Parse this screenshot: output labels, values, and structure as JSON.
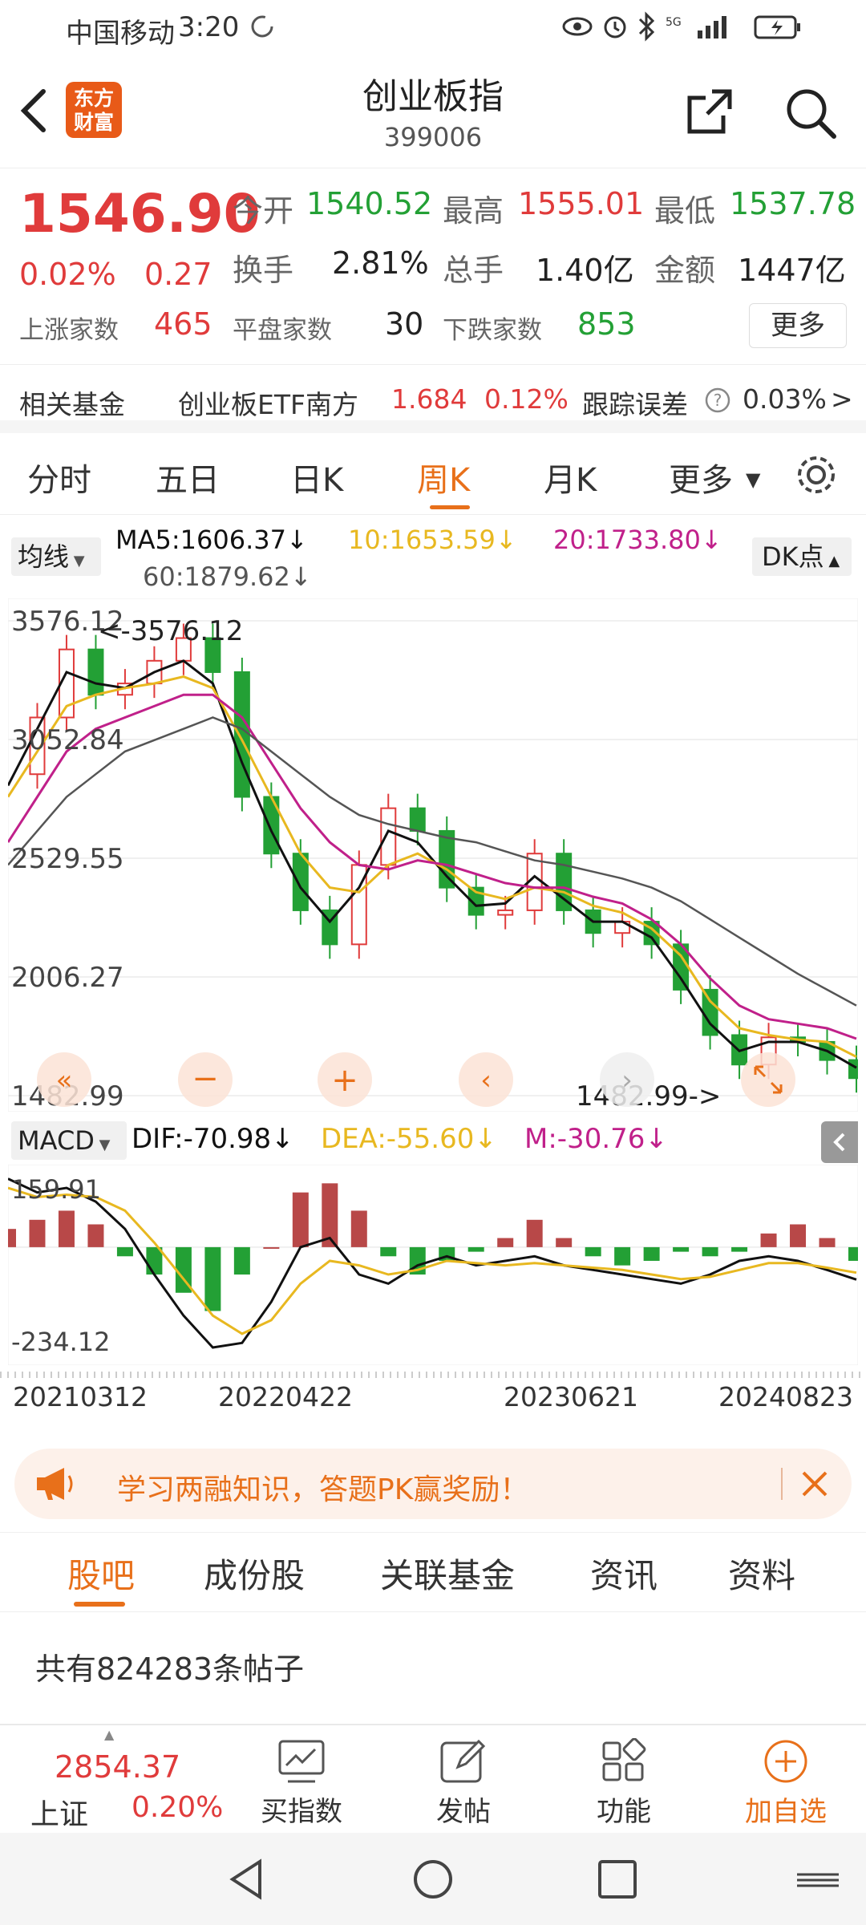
{
  "status": {
    "carrier": "中国移动",
    "time": "3:20"
  },
  "header": {
    "logo_line1": "东方",
    "logo_line2": "财富",
    "title": "创业板指",
    "code": "399006"
  },
  "quote": {
    "price": "1546.90",
    "change_pct": "0.02%",
    "change": "0.27",
    "open_label": "今开",
    "open": "1540.52",
    "high_label": "最高",
    "high": "1555.01",
    "low_label": "最低",
    "low": "1537.78",
    "turnover_label": "换手",
    "turnover": "2.81%",
    "volume_label": "总手",
    "volume": "1.40亿",
    "amount_label": "金额",
    "amount": "1447亿",
    "up_label": "上涨家数",
    "up": "465",
    "flat_label": "平盘家数",
    "flat": "30",
    "down_label": "下跌家数",
    "down": "853",
    "more_button": "更多"
  },
  "fund": {
    "label": "相关基金",
    "name": "创业板ETF南方",
    "price": "1.684",
    "pct": "0.12%",
    "track_label": "跟踪误差",
    "track_value": "0.03%"
  },
  "tabs": [
    "分时",
    "五日",
    "日K",
    "周K",
    "月K",
    "更多"
  ],
  "ma": {
    "selector": "均线",
    "ma5": "MA5:1606.37↓",
    "ma10": "10:1653.59↓",
    "ma20": "20:1733.80↓",
    "ma60": "60:1879.62↓",
    "dk_button": "DK点"
  },
  "chart_data": [
    {
      "type": "candlestick",
      "y_ticks": [
        "3576.12",
        "3052.84",
        "2529.55",
        "2006.27",
        "1482.99"
      ],
      "ylim": [
        1482.99,
        3576.12
      ],
      "max_label": "<-3576.12",
      "min_label": "1482.99->",
      "x_ticks": [
        "20210312",
        "20220422",
        "20230621",
        "20240823"
      ],
      "series": [
        {
          "values": [
            2900,
            3150,
            3450,
            3250,
            3300,
            3400,
            3500,
            3350,
            2800,
            2550,
            2300,
            2150,
            2500,
            2750,
            2650,
            2400,
            2280,
            2300,
            2550,
            2300,
            2200,
            2250,
            2150,
            1950,
            1750,
            1620,
            1740,
            1720,
            1640,
            1560
          ]
        },
        {
          "values": [
            2850,
            3100,
            3350,
            3300,
            3280,
            3350,
            3400,
            3300,
            2950,
            2650,
            2400,
            2250,
            2400,
            2650,
            2600,
            2450,
            2320,
            2330,
            2450,
            2350,
            2250,
            2250,
            2180,
            2000,
            1800,
            1680,
            1720,
            1720,
            1680,
            1606
          ]
        },
        {
          "values": [
            2800,
            3000,
            3200,
            3250,
            3280,
            3300,
            3330,
            3280,
            3050,
            2800,
            2550,
            2400,
            2380,
            2500,
            2550,
            2480,
            2380,
            2350,
            2400,
            2380,
            2320,
            2290,
            2220,
            2100,
            1900,
            1780,
            1750,
            1730,
            1720,
            1654
          ]
        },
        {
          "values": [
            2600,
            2800,
            3000,
            3100,
            3150,
            3200,
            3250,
            3250,
            3150,
            2950,
            2750,
            2600,
            2500,
            2480,
            2520,
            2500,
            2460,
            2420,
            2400,
            2400,
            2360,
            2330,
            2260,
            2150,
            2000,
            1880,
            1820,
            1800,
            1780,
            1734
          ]
        },
        {
          "values": [
            2500,
            2650,
            2800,
            2900,
            3000,
            3050,
            3100,
            3150,
            3100,
            3000,
            2900,
            2800,
            2720,
            2680,
            2650,
            2620,
            2600,
            2560,
            2520,
            2500,
            2470,
            2440,
            2400,
            2340,
            2260,
            2180,
            2100,
            2020,
            1950,
            1880
          ]
        }
      ]
    },
    {
      "type": "bar",
      "selector": "MACD",
      "dif": "DIF:-70.98↓",
      "dea": "DEA:-55.60↓",
      "m": "M:-30.76↓",
      "y_ticks": [
        "159.91",
        "-234.12"
      ],
      "ylim": [
        -234.12,
        159.91
      ],
      "values": [
        40,
        60,
        80,
        50,
        -20,
        -60,
        -100,
        -140,
        -60,
        0,
        120,
        140,
        80,
        -20,
        -60,
        -30,
        -10,
        20,
        60,
        20,
        -20,
        -40,
        -30,
        -10,
        -20,
        -10,
        30,
        50,
        20,
        -30
      ],
      "series": [
        {
          "values": [
            150,
            120,
            130,
            100,
            40,
            -60,
            -150,
            -220,
            -210,
            -120,
            0,
            20,
            -60,
            -80,
            -40,
            -20,
            -40,
            -30,
            -20,
            -40,
            -50,
            -60,
            -70,
            -80,
            -60,
            -30,
            -20,
            -30,
            -50,
            -71
          ]
        },
        {
          "values": [
            130,
            110,
            115,
            110,
            80,
            10,
            -70,
            -150,
            -190,
            -160,
            -80,
            -30,
            -40,
            -60,
            -50,
            -30,
            -35,
            -40,
            -35,
            -40,
            -45,
            -50,
            -60,
            -70,
            -65,
            -50,
            -35,
            -35,
            -45,
            -56
          ]
        }
      ]
    }
  ],
  "banner": {
    "text": "学习两融知识，答题PK赢奖励！"
  },
  "bottom_tabs": [
    "股吧",
    "成份股",
    "关联基金",
    "资讯",
    "资料"
  ],
  "posts": {
    "count_text": "共有824283条帖子"
  },
  "toolbar": {
    "index_value": "2854.37",
    "index_name": "上证",
    "index_pct": "0.20%",
    "buy_index": "买指数",
    "post": "发帖",
    "functions": "功能",
    "add_watch": "加自选"
  },
  "colors": {
    "up": "#e03b3b",
    "down": "#23a035",
    "accent": "#e8701a",
    "ma5": "#111111",
    "ma10": "#e8b820",
    "ma20": "#c0208a",
    "ma60": "#555555"
  }
}
